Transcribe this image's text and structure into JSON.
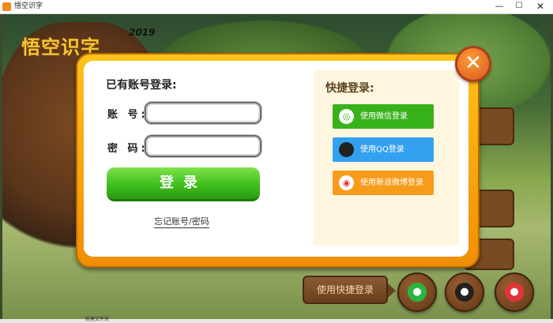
{
  "window": {
    "title": "悟空识字",
    "minimize": "—",
    "maximize": "☐",
    "close": "✕"
  },
  "game": {
    "logo": "悟空识字",
    "year": "2019",
    "quick_login_bar": "使用快捷登录"
  },
  "login": {
    "title": "已有账号登录:",
    "account_label": "账 号:",
    "password_label": "密 码:",
    "account_value": "",
    "password_value": "",
    "submit": "登录",
    "forgot": "忘记账号/密码",
    "close_glyph": "✕"
  },
  "quick_login": {
    "title": "快捷登录:",
    "wechat": "使用微信登录",
    "qq": "使用QQ登录",
    "weibo": "使用新浪微博登录"
  },
  "taskbar": {
    "label": "新建文件夹"
  },
  "colors": {
    "frame_orange": "#f5a10f",
    "login_green": "#3fbf1c",
    "wechat_green": "#37b21b",
    "qq_blue": "#33a1f0",
    "weibo_orange": "#f79b1a"
  }
}
